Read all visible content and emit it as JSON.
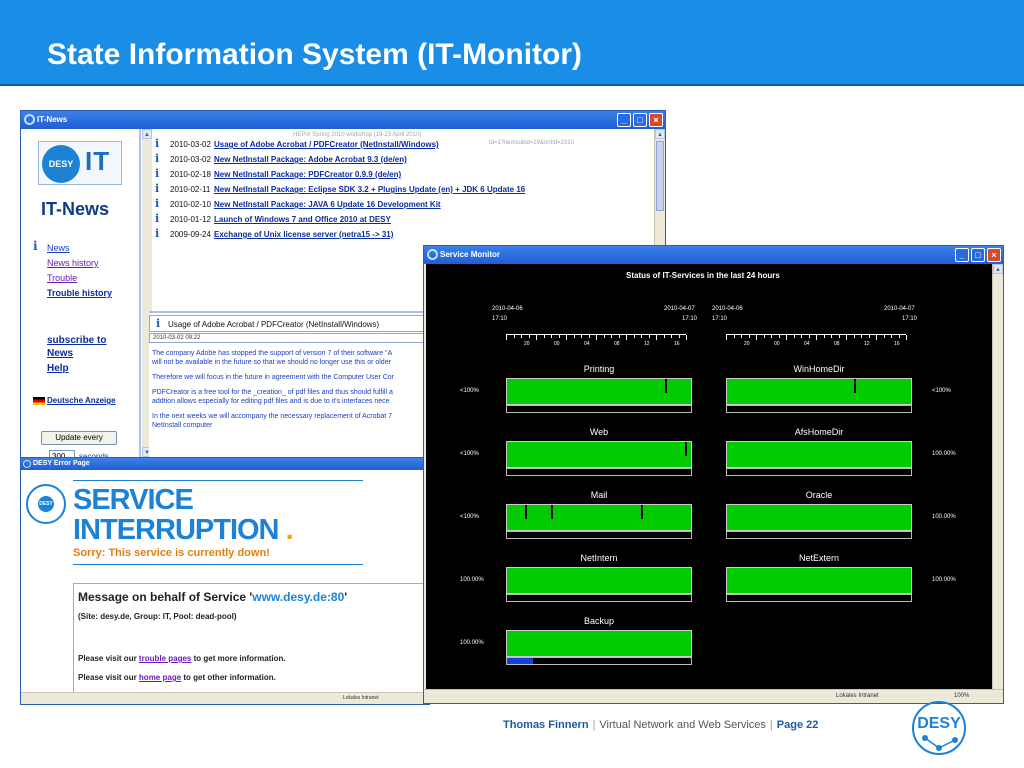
{
  "slide": {
    "title": "State Information System (IT-Monitor)",
    "footer": {
      "author": "Thomas Finnern",
      "sep": "|",
      "subtitle": "Virtual Network and Web Services",
      "page_label": "Page 22"
    },
    "logo_text": "DESY"
  },
  "it_news": {
    "window_title": "IT-News",
    "logo_left": "DESY",
    "logo_right": "IT",
    "heading": "IT-News",
    "nav": [
      "News",
      "News history",
      "Trouble",
      "Trouble history"
    ],
    "nav_sub": [
      "subscribe to",
      "News",
      "Help"
    ],
    "language_link": "Deutsche Anzeige",
    "update_button": "Update every",
    "update_value": "300",
    "update_unit": "seconds",
    "tooltip_1": "HEPiX Spring 2010 workshop (19-23 April 2010)",
    "tooltip_2": "td=1?itemsubid=29&onfid=2310",
    "items": [
      {
        "date": "2010-03-02",
        "title": "Usage of Adobe Acrobat / PDFCreator (NetInstall/Windows)"
      },
      {
        "date": "2010-03-02",
        "title": "New NetInstall Package: Adobe Acrobat 9.3 (de/en)"
      },
      {
        "date": "2010-02-18",
        "title": "New NetInstall Package: PDFCreator 0.9.9 (de/en)"
      },
      {
        "date": "2010-02-11",
        "title": "New NetInstall Package: Eclipse SDK 3.2 + Plugins Update (en) + JDK 6 Update 16"
      },
      {
        "date": "2010-02-10",
        "title": "New NetInstall Package: JAVA 6 Update 16 Development Kit"
      },
      {
        "date": "2010-01-12",
        "title": "Launch of Windows 7 and Office 2010 at DESY"
      },
      {
        "date": "2009-09-24",
        "title": "Exchange of Unix license server (netra15 -> 31)"
      }
    ],
    "detail": {
      "title": "Usage of Adobe Acrobat / PDFCreator (NetInstall/Windows)",
      "date": "2010-03-02 09:22",
      "paragraphs": [
        "The company Adobe has stopped the support of version 7 of their software \"A",
        "will not be available in the future so that we should no longer use this or older",
        "Therefore we will focus in the future in agreement with the Computer User Cor",
        "PDFCreator is a free tool for the _creation_ of pdf files and thus should fulfill a",
        "addtion allows especially for editing pdf files and is due to it's interfaces nece",
        "In the next weeks we will accompany the necessary replacement of Acrobat 7",
        "NetInstall computer"
      ]
    }
  },
  "error_page": {
    "window_title": "DESY Error Page",
    "logo_text": "DESY",
    "title_line1": "SERVICE",
    "title_line2": "INTERRUPTION",
    "title_dot": ".",
    "sorry": "Sorry: This service is currently down!",
    "msg_prefix": "Message on behalf of Service '",
    "service": "www.desy.de:80",
    "msg_suffix": "'",
    "site_info": "(Site: desy.de, Group: IT, Pool: dead-pool)",
    "visit1_prefix": "Please visit our ",
    "visit1_link": "trouble pages",
    "visit1_suffix": " to get more information.",
    "visit2_prefix": "Please visit our ",
    "visit2_link": "home page",
    "visit2_suffix": " to get other information.",
    "status_zone": "Lokales Intranet"
  },
  "monitor": {
    "window_title": "Service Monitor",
    "heading": "Status of IT-Services in the last 24 hours",
    "axis_left": {
      "start_date": "2010-04-06",
      "start_time": "17:10",
      "end_date": "2010-04-07",
      "end_time": "17:10"
    },
    "axis_right": {
      "start_date": "2010-04-06",
      "start_time": "17:10",
      "end_date": "2010-04-07",
      "end_time": "17:10"
    },
    "hour_ticks": [
      "20",
      "00",
      "04",
      "08",
      "12",
      "16"
    ],
    "status_zone": "Lokales Intranet",
    "zoom": "100%",
    "colors": {
      "up": "#00cc00",
      "down": "#000000",
      "planned": "#1540d8"
    },
    "services": [
      {
        "name": "Printing",
        "availability": "<100%",
        "outages": [
          0.86
        ],
        "planned": 0
      },
      {
        "name": "WinHomeDir",
        "availability": "<100%",
        "outages": [
          0.69
        ],
        "planned": 0
      },
      {
        "name": "Web",
        "availability": "<100%",
        "outages": [
          0.965
        ],
        "planned": 0
      },
      {
        "name": "AfsHomeDir",
        "availability": "100.00%",
        "outages": [],
        "planned": 0
      },
      {
        "name": "Mail",
        "availability": "<100%",
        "outages": [
          0.1,
          0.24,
          0.73
        ],
        "planned": 0
      },
      {
        "name": "Oracle",
        "availability": "100.00%",
        "outages": [],
        "planned": 0
      },
      {
        "name": "NetIntern",
        "availability": "100.00%",
        "outages": [],
        "planned": 0
      },
      {
        "name": "NetExtern",
        "availability": "100.00%",
        "outages": [],
        "planned": 0
      },
      {
        "name": "Backup",
        "availability": "100.00%",
        "outages": [],
        "planned": 0.14
      }
    ]
  }
}
